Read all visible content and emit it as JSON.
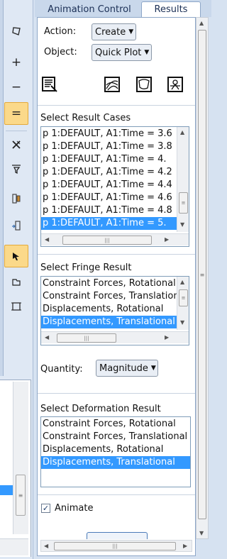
{
  "tabs": {
    "animation_control": "Animation Control",
    "results": "Results"
  },
  "action": {
    "label": "Action:",
    "value": "Create"
  },
  "object": {
    "label": "Object:",
    "value": "Quick Plot"
  },
  "toolbar_icons": [
    "select-results-icon",
    "fringe-attributes-icon",
    "deformation-attributes-icon",
    "animation-options-icon"
  ],
  "result_cases": {
    "title": "Select Result Cases",
    "items": [
      "p 1:DEFAULT, A1:Time = 3.6",
      "p 1:DEFAULT, A1:Time = 3.8",
      "p 1:DEFAULT, A1:Time = 4.",
      "p 1:DEFAULT, A1:Time = 4.2",
      "p 1:DEFAULT, A1:Time = 4.4",
      "p 1:DEFAULT, A1:Time = 4.6",
      "p 1:DEFAULT, A1:Time = 4.8",
      "p 1:DEFAULT, A1:Time = 5."
    ],
    "selected_index": 7
  },
  "fringe_result": {
    "title": "Select Fringe Result",
    "items": [
      "Constraint Forces, Rotational",
      "Constraint Forces, Translational",
      "Displacements, Rotational",
      "Displacements, Translational"
    ],
    "selected_index": 3
  },
  "quantity": {
    "label": "Quantity:",
    "value": "Magnitude"
  },
  "deformation_result": {
    "title": "Select Deformation Result",
    "items": [
      "Constraint Forces, Rotational",
      "Constraint Forces, Translational",
      "Displacements, Rotational",
      "Displacements, Translational"
    ],
    "selected_index": 3
  },
  "animate": {
    "label": "Animate",
    "checked": true
  },
  "left_tools": [
    "polygon-select-icon",
    "zoom-in-icon",
    "zoom-out-icon",
    "fit-view-icon",
    "delete-icon",
    "filter-icon",
    "stack-icon",
    "transfer-icon",
    "pointer-icon",
    "rectangle-icon",
    "view-frame-icon"
  ]
}
